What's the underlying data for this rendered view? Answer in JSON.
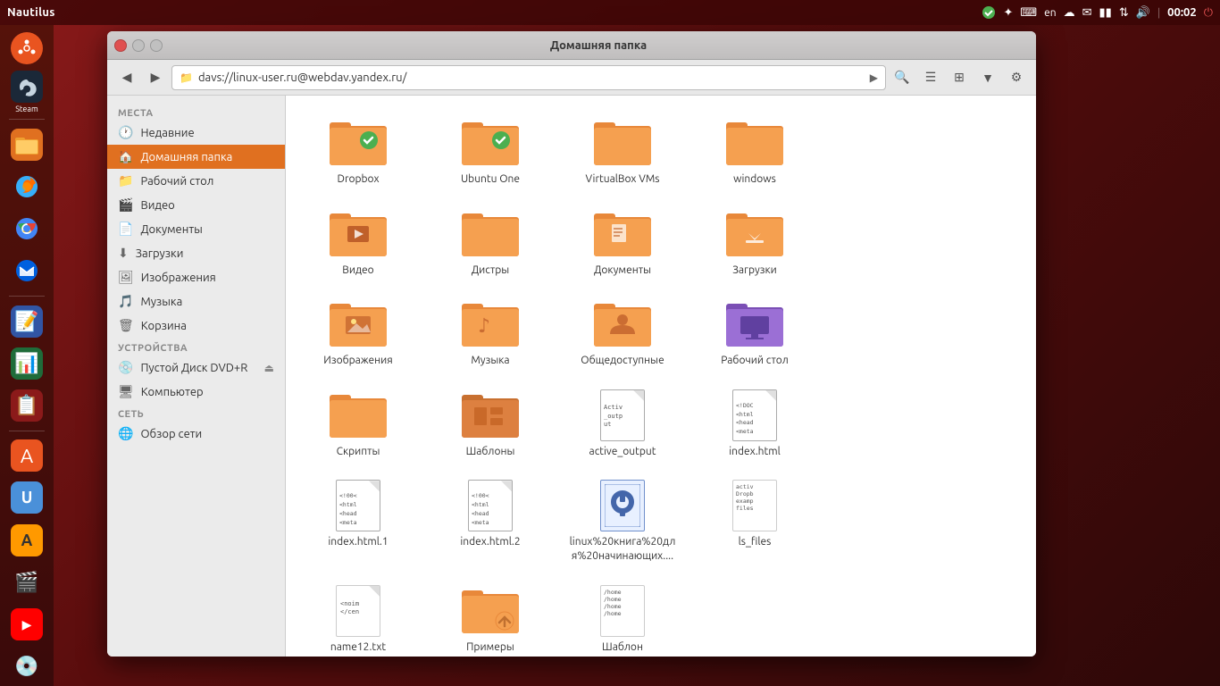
{
  "desktop": {
    "topPanel": {
      "title": "Nautilus",
      "time": "00:02",
      "lang": "en"
    }
  },
  "launcher": {
    "items": [
      {
        "id": "ubuntu",
        "label": "",
        "type": "ubuntu"
      },
      {
        "id": "steam",
        "label": "Steam",
        "type": "steam"
      },
      {
        "id": "files",
        "label": "",
        "type": "files"
      },
      {
        "id": "firefox",
        "label": "",
        "type": "firefox"
      },
      {
        "id": "chromium",
        "label": "",
        "type": "chromium"
      },
      {
        "id": "thunderbird",
        "label": "",
        "type": "thunderbird"
      },
      {
        "id": "writer",
        "label": "",
        "type": "writer"
      },
      {
        "id": "calc",
        "label": "",
        "type": "calc"
      },
      {
        "id": "impress",
        "label": "",
        "type": "impress"
      },
      {
        "id": "install",
        "label": "",
        "type": "install"
      },
      {
        "id": "ubuntu-one",
        "label": "",
        "type": "ubuntu-one"
      },
      {
        "id": "amazon",
        "label": "",
        "type": "amazon"
      },
      {
        "id": "media",
        "label": "",
        "type": "media"
      },
      {
        "id": "youtube",
        "label": "",
        "type": "youtube"
      },
      {
        "id": "disk",
        "label": "",
        "type": "disk"
      }
    ]
  },
  "window": {
    "title": "Домашняя папка",
    "addressBar": "davs://linux-user.ru@webdav.yandex.ru/"
  },
  "sidebar": {
    "sections": [
      {
        "label": "Места",
        "items": [
          {
            "id": "recent",
            "label": "Недавние",
            "icon": "clock",
            "active": false
          },
          {
            "id": "home",
            "label": "Домашняя папка",
            "icon": "home",
            "active": true
          },
          {
            "id": "desktop",
            "label": "Рабочий стол",
            "icon": "folder",
            "active": false
          },
          {
            "id": "video",
            "label": "Видео",
            "icon": "film",
            "active": false
          },
          {
            "id": "docs",
            "label": "Документы",
            "icon": "doc",
            "active": false
          },
          {
            "id": "downloads",
            "label": "Загрузки",
            "icon": "download",
            "active": false
          },
          {
            "id": "images",
            "label": "Изображения",
            "icon": "image",
            "active": false
          },
          {
            "id": "music",
            "label": "Музыка",
            "icon": "music",
            "active": false
          },
          {
            "id": "trash",
            "label": "Корзина",
            "icon": "trash",
            "active": false
          }
        ]
      },
      {
        "label": "Устройства",
        "items": [
          {
            "id": "dvd",
            "label": "Пустой Диск DVD+R",
            "icon": "disc",
            "active": false,
            "eject": true
          },
          {
            "id": "computer",
            "label": "Компьютер",
            "icon": "computer",
            "active": false
          }
        ]
      },
      {
        "label": "Сеть",
        "items": [
          {
            "id": "network",
            "label": "Обзор сети",
            "icon": "network",
            "active": false
          }
        ]
      }
    ]
  },
  "files": [
    {
      "id": "dropbox",
      "label": "Dropbox",
      "type": "folder-check-green"
    },
    {
      "id": "ubuntu-one",
      "label": "Ubuntu One",
      "type": "folder-check-green2"
    },
    {
      "id": "virtualbox",
      "label": "VirtualBox VMs",
      "type": "folder-plain"
    },
    {
      "id": "windows",
      "label": "windows",
      "type": "folder-plain"
    },
    {
      "id": "video",
      "label": "Видео",
      "type": "folder-video"
    },
    {
      "id": "distros",
      "label": "Дистры",
      "type": "folder-plain"
    },
    {
      "id": "documents",
      "label": "Документы",
      "type": "folder-docs"
    },
    {
      "id": "downloads",
      "label": "Загрузки",
      "type": "folder-download"
    },
    {
      "id": "images",
      "label": "Изображения",
      "type": "folder-images"
    },
    {
      "id": "music",
      "label": "Музыка",
      "type": "folder-music"
    },
    {
      "id": "public",
      "label": "Общедоступные",
      "type": "folder-public"
    },
    {
      "id": "desktop-folder",
      "label": "Рабочий стол",
      "type": "folder-desktop"
    },
    {
      "id": "scripts",
      "label": "Скрипты",
      "type": "folder-plain"
    },
    {
      "id": "templates",
      "label": "Шаблоны",
      "type": "folder-templates"
    },
    {
      "id": "active-output",
      "label": "active_output",
      "type": "file-txt-activ"
    },
    {
      "id": "index-html",
      "label": "index.html",
      "type": "file-html"
    },
    {
      "id": "index-html1",
      "label": "index.html.1",
      "type": "file-html2"
    },
    {
      "id": "index-html2",
      "label": "index.html.2",
      "type": "file-html2"
    },
    {
      "id": "linux-book",
      "label": "linux%20книга%20для%20начинающих....",
      "type": "file-odt"
    },
    {
      "id": "ls-files",
      "label": "ls_files",
      "type": "file-ls"
    },
    {
      "id": "name12",
      "label": "name12.txt",
      "type": "file-name-txt"
    },
    {
      "id": "examples",
      "label": "Примеры",
      "type": "folder-link"
    },
    {
      "id": "shablon",
      "label": "Шаблон",
      "type": "file-shab"
    }
  ]
}
